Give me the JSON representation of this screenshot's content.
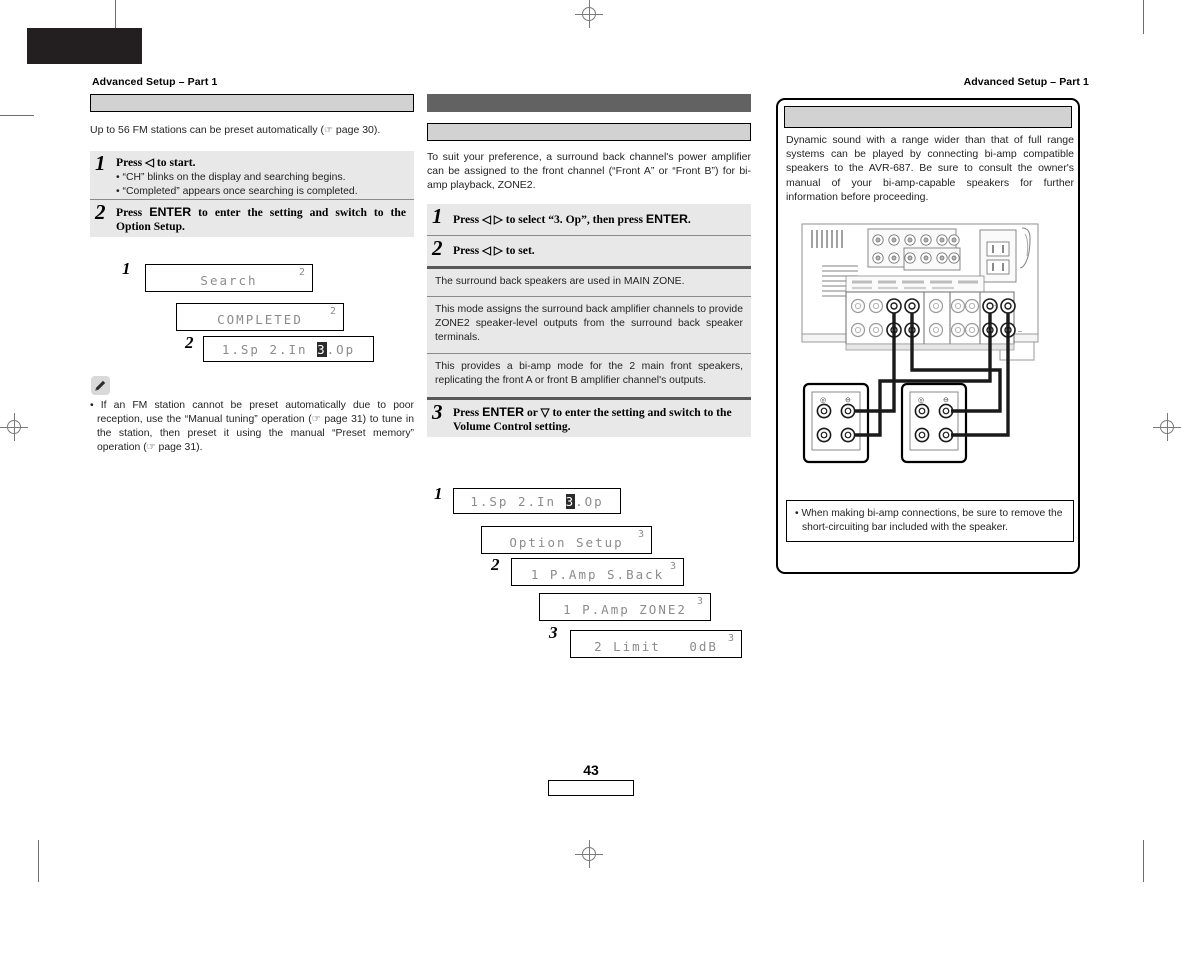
{
  "document": {
    "page_number": "43",
    "running_head_left": "Advanced Setup – Part 1",
    "running_head_right": "Advanced Setup – Part 1"
  },
  "left_column": {
    "section_bar_label": "",
    "intro": "Up to 56 FM stations can be preset automatically (☞ page 30).",
    "intro_plain": "Up to 56 FM stations can be preset automatically (",
    "intro_pageref": "page 30).",
    "steps": [
      {
        "number": "1",
        "title_pre": "Press ",
        "title_key": "◁",
        "title_post": " to start.",
        "bullets": [
          "“CH” blinks on the display and searching begins.",
          "“Completed” appears once searching is completed."
        ]
      },
      {
        "number": "2",
        "title_pre": "Press ",
        "title_key": "ENTER",
        "title_post": " to enter the setting and switch to the Option Setup.",
        "bullets": []
      }
    ],
    "displays": [
      {
        "label": "1",
        "text": "Search",
        "corner": "2",
        "highlight": ""
      },
      {
        "label": "",
        "text": "COMPLETED",
        "corner": "2",
        "highlight": ""
      },
      {
        "label": "2",
        "text": "1.Sp 2.In 3.Op",
        "corner": "",
        "highlight": "3"
      }
    ],
    "note": {
      "icon": "pencil-icon",
      "bullets": [
        "If an FM station cannot be preset automatically due to poor reception, use the “Manual tuning” operation (☞ page 31) to tune in the station, then preset it using the manual “Preset memory” operation (☞ page 31)."
      ]
    }
  },
  "middle_column": {
    "section_bar_label": "",
    "subsection_bar_label": "",
    "intro": "To suit your preference, a surround back channel's power amplifier can be assigned to the front channel (“Front A” or “Front B”) for bi-amp playback, ZONE2.",
    "steps": [
      {
        "number": "1",
        "title_pre": "Press ",
        "title_key": "◁ ▷",
        "title_post": " to select “3. Op”, then press ",
        "title_key2": "ENTER",
        "title_end": "."
      },
      {
        "number": "2",
        "title_pre": "Press ",
        "title_key": "◁ ▷",
        "title_post": " to set.",
        "title_key2": "",
        "title_end": ""
      }
    ],
    "mode_descriptions": [
      "The surround back speakers are used in MAIN ZONE.",
      "This mode assigns the surround back amplifier channels to provide ZONE2 speaker-level outputs from the surround back speaker terminals.",
      "This provides a bi-amp mode for the 2 main front speakers, replicating the front A or front B amplifier channel's outputs."
    ],
    "step3": {
      "number": "3",
      "title_pre": "Press ",
      "title_key": "ENTER",
      "title_mid": " or ",
      "title_key2": "▽",
      "title_post": " to enter the setting and switch to the Volume Control setting."
    },
    "displays": [
      {
        "label": "1",
        "text": "1.Sp 2.In 3.Op",
        "corner": "",
        "highlight": "3"
      },
      {
        "label": "",
        "text": "Option Setup",
        "corner": "3",
        "highlight": ""
      },
      {
        "label": "2",
        "text": "1 P.Amp S.Back",
        "corner": "3",
        "highlight": ""
      },
      {
        "label": "",
        "text": "1 P.Amp ZONE2",
        "corner": "3",
        "highlight": ""
      },
      {
        "label": "3",
        "text": "2 Limit   0dB",
        "corner": "3",
        "highlight": ""
      }
    ]
  },
  "right_column": {
    "panel_head_label": "",
    "body": "Dynamic sound with a range wider than that of full range systems can be played by connecting bi-amp compatible speakers to the AVR-687. Be sure to consult the owner's manual of your bi-amp-capable speakers for further information before proceeding.",
    "diagram": {
      "name": "bi-amp-connection-diagram",
      "receiver_model": "AVR-687",
      "speaker_terminal_labels": [
        "+",
        "–"
      ]
    },
    "note": {
      "bullets": [
        "When making bi-amp connections, be sure to remove the short-circuiting bar included with the speaker."
      ]
    }
  },
  "colors": {
    "dark_bar": "#636263",
    "light_bar": "#d2d2d2",
    "step_bg": "#e8e8e8",
    "lcd_text": "#8c8c8c",
    "text": "#231f20"
  }
}
